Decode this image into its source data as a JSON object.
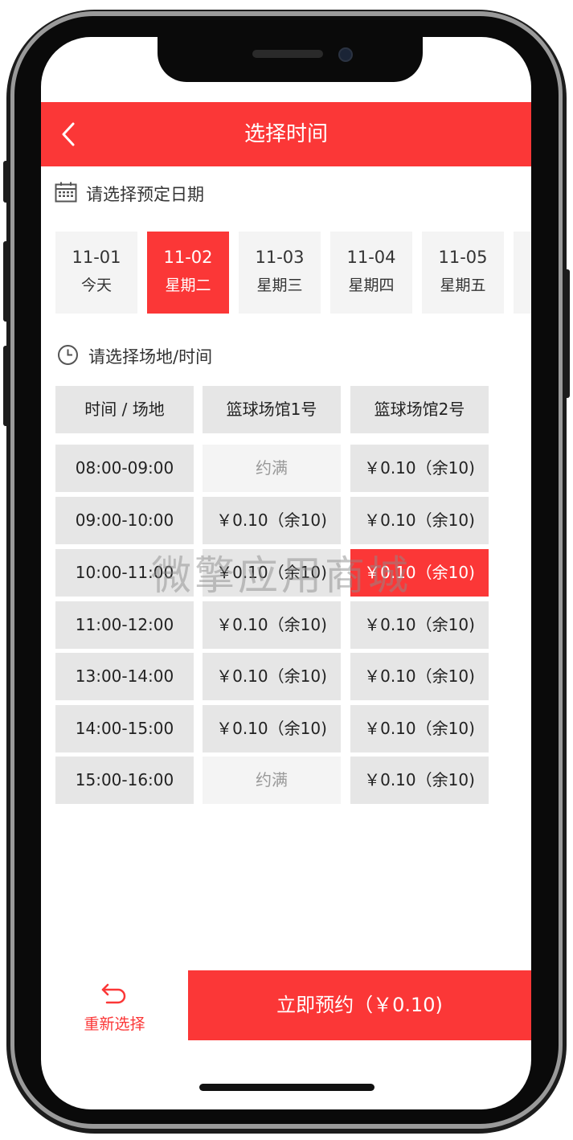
{
  "header": {
    "title": "选择时间"
  },
  "date_section": {
    "label": "请选择预定日期"
  },
  "dates": [
    {
      "date": "11-01",
      "weekday": "今天",
      "selected": false
    },
    {
      "date": "11-02",
      "weekday": "星期二",
      "selected": true
    },
    {
      "date": "11-03",
      "weekday": "星期三",
      "selected": false
    },
    {
      "date": "11-04",
      "weekday": "星期四",
      "selected": false
    },
    {
      "date": "11-05",
      "weekday": "星期五",
      "selected": false
    }
  ],
  "venue_section": {
    "label": "请选择场地/时间"
  },
  "table": {
    "headers": [
      "时间 / 场地",
      "篮球场馆1号",
      "篮球场馆2号"
    ],
    "rows": [
      {
        "time": "08:00-09:00",
        "v1": "约满",
        "v2": "￥0.10（余10)"
      },
      {
        "time": "09:00-10:00",
        "v1": "￥0.10（余10)",
        "v2": "￥0.10（余10)"
      },
      {
        "time": "10:00-11:00",
        "v1": "￥0.10（余10)",
        "v2": "￥0.10（余10)"
      },
      {
        "time": "11:00-12:00",
        "v1": "￥0.10（余10)",
        "v2": "￥0.10（余10)"
      },
      {
        "time": "13:00-14:00",
        "v1": "￥0.10（余10)",
        "v2": "￥0.10（余10)"
      },
      {
        "time": "14:00-15:00",
        "v1": "￥0.10（余10)",
        "v2": "￥0.10（余10)"
      },
      {
        "time": "15:00-16:00",
        "v1": "约满",
        "v2": "￥0.10（余10)"
      }
    ]
  },
  "watermark": "微擎应用商城",
  "footer": {
    "reset_label": "重新选择",
    "book_label": "立即预约（￥0.10)"
  },
  "colors": {
    "accent": "#fb3737",
    "cell": "#e6e6e6",
    "full_cell": "#f4f4f4"
  }
}
